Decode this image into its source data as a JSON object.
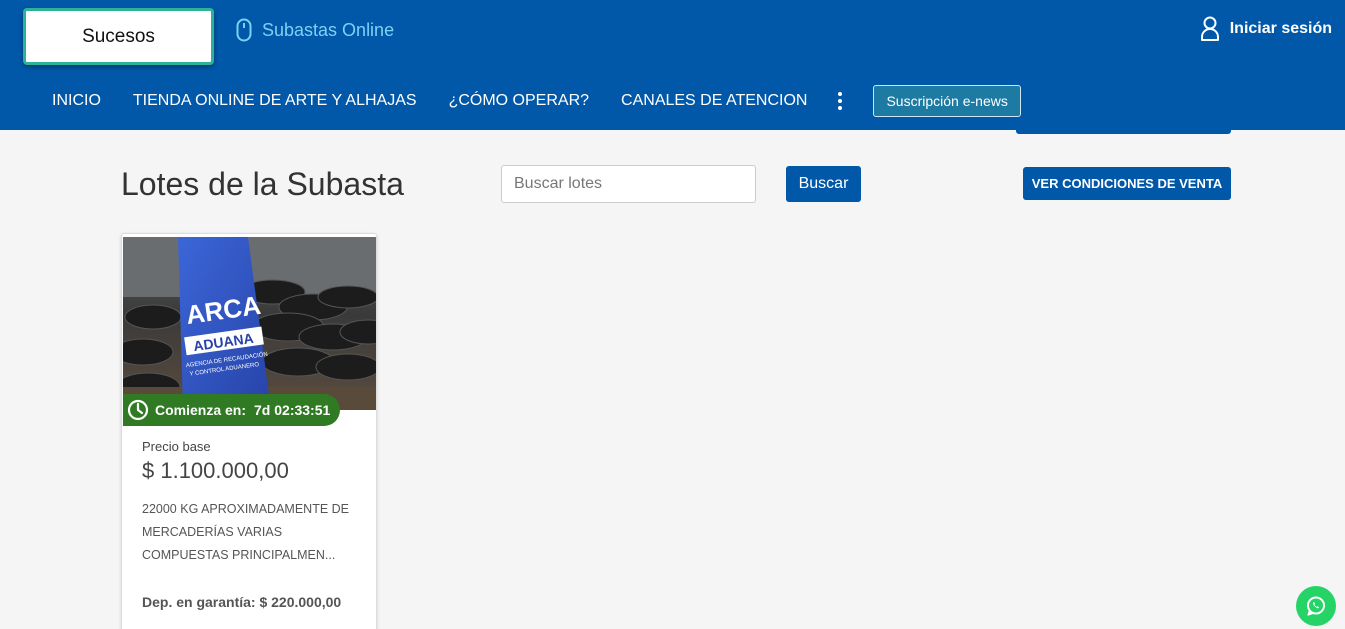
{
  "header": {
    "brand_label": "Sucesos",
    "subastas_label": "Subastas Online",
    "login_label": "Iniciar sesión"
  },
  "nav": {
    "items": [
      {
        "label": "INICIO"
      },
      {
        "label": "TIENDA ONLINE DE ARTE Y ALHAJAS"
      },
      {
        "label": "¿CÓMO OPERAR?"
      },
      {
        "label": "CANALES DE ATENCION"
      }
    ],
    "enews_label": "Suscripción e-news"
  },
  "main": {
    "title": "Lotes de la Subasta",
    "search_placeholder": "Buscar lotes",
    "search_button": "Buscar",
    "conditions_button": "VER CONDICIONES DE VENTA"
  },
  "lots": [
    {
      "image_text_1": "ARCA",
      "image_text_2": "ADUANA",
      "image_text_3": "AGENCIA DE RECAUDACIÓN",
      "image_text_4": "Y CONTROL ADUANERO",
      "countdown_label": "Comienza en:",
      "countdown_value": "7d 02:33:51",
      "price_label": "Precio base",
      "price": "$ 1.100.000,00",
      "description": "22000 KG APROXIMADAMENTE DE MERCADERÍAS VARIAS COMPUESTAS PRINCIPALMEN...",
      "deposit": "Dep. en garantía: $ 220.000,00"
    }
  ],
  "colors": {
    "header_bg": "#0157a8",
    "brand_border": "#2bb39a",
    "countdown_bg": "#2f7a22",
    "whatsapp": "#25d366"
  }
}
